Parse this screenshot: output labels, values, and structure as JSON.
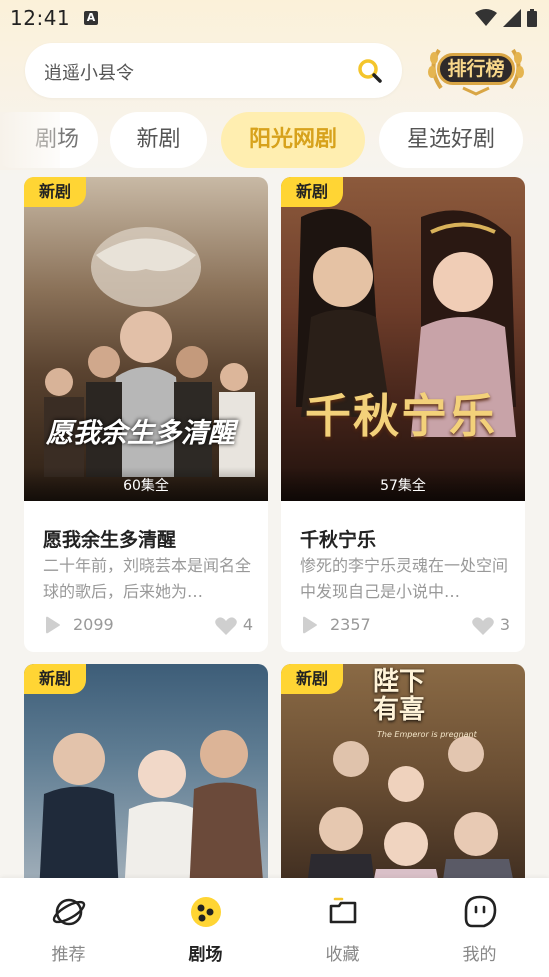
{
  "status_bar": {
    "time": "12:41",
    "notification_icon": "A"
  },
  "search": {
    "placeholder": "逍遥小县令"
  },
  "ranking_button": {
    "label": "排行榜"
  },
  "tabs": [
    {
      "label": "剧场",
      "active": false
    },
    {
      "label": "新剧",
      "active": false
    },
    {
      "label": "阳光网剧",
      "active": true
    },
    {
      "label": "星选好剧",
      "active": false
    }
  ],
  "cards": [
    {
      "badge": "新剧",
      "poster_title": "愿我余生多清醒",
      "episodes": "60集全",
      "title": "愿我余生多清醒",
      "description": "二十年前，刘晓芸本是闻名全球的歌后，后来她为…",
      "plays": "2099",
      "likes": "4"
    },
    {
      "badge": "新剧",
      "poster_title": "千秋宁乐",
      "episodes": "57集全",
      "title": "千秋宁乐",
      "description": "惨死的李宁乐灵魂在一处空间中发现自己是小说中…",
      "plays": "2357",
      "likes": "3"
    },
    {
      "badge": "新剧",
      "poster_title": ""
    },
    {
      "badge": "新剧",
      "poster_title": "陛下有喜",
      "poster_subtitle": "The Emperor is pregnant"
    }
  ],
  "bottom_nav": [
    {
      "label": "推荐",
      "icon": "planet-icon",
      "active": false
    },
    {
      "label": "剧场",
      "icon": "theater-icon",
      "active": true
    },
    {
      "label": "收藏",
      "icon": "collection-icon",
      "active": false
    },
    {
      "label": "我的",
      "icon": "profile-icon",
      "active": false
    }
  ],
  "colors": {
    "accent": "#ffd534",
    "active_tab_bg": "#ffeeb0",
    "active_tab_text": "#d7a21c"
  }
}
